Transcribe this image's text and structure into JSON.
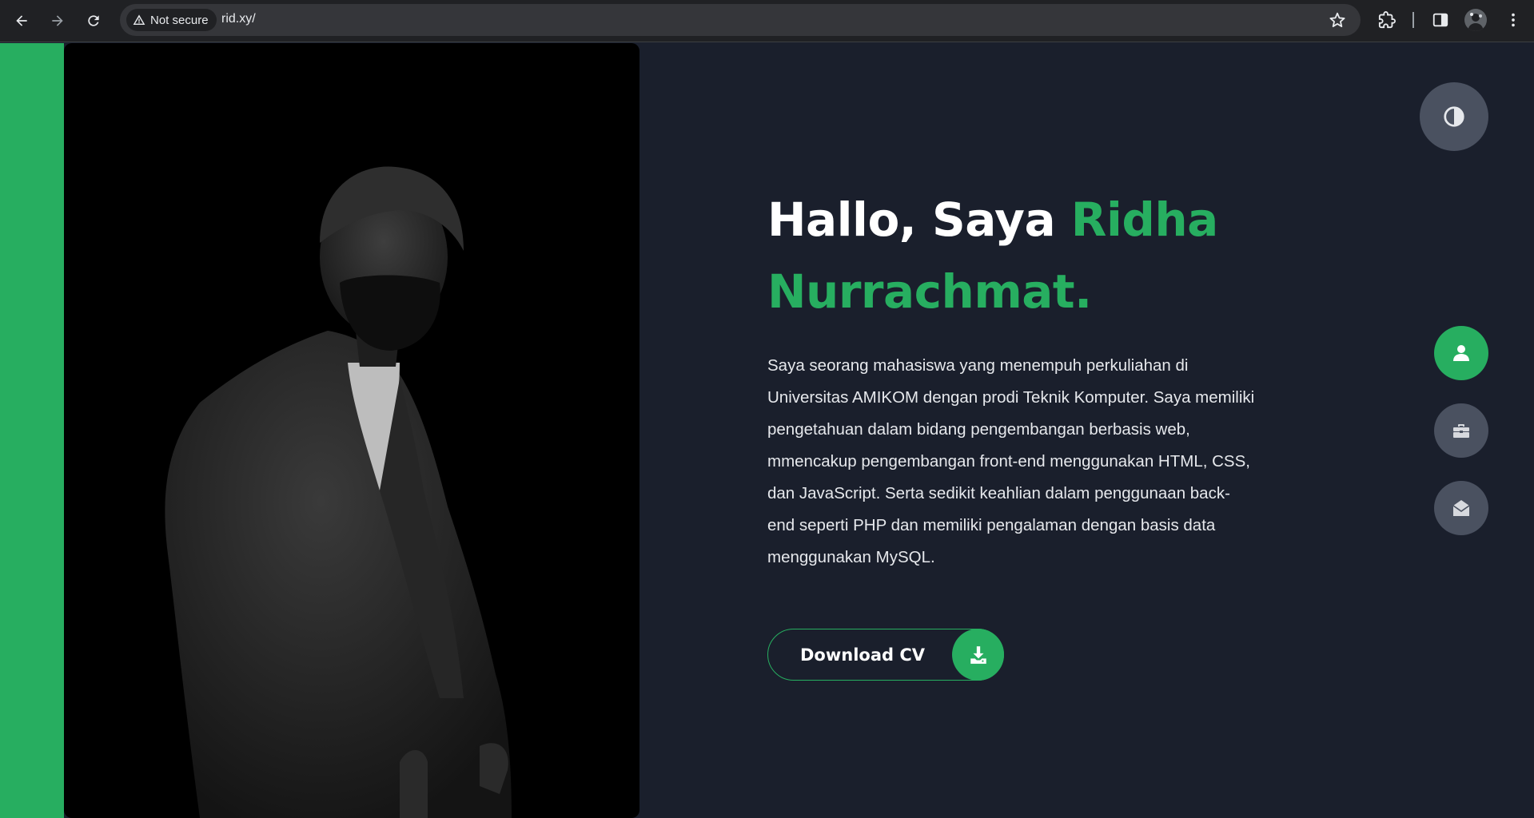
{
  "browser": {
    "security_label": "Not secure",
    "url": "rid.xy/"
  },
  "hero": {
    "greeting": "Hallo, Saya ",
    "name_first": "Ridha",
    "name_last": "Nurrachmat.",
    "bio": "Saya seorang mahasiswa yang menempuh perkuliahan di Universitas AMIKOM dengan prodi Teknik Komputer. Saya memiliki pengetahuan dalam bidang pengembangan berbasis web, mmencakup pengembangan front-end menggunakan HTML, CSS, dan JavaScript. Serta sedikit keahlian dalam penggunaan back-end seperti PHP dan memiliki pengalaman dengan basis data menggunakan MySQL.",
    "cv_button_label": "Download CV"
  },
  "colors": {
    "accent": "#27ae60",
    "background": "#1a1f2c",
    "button_gray": "#4a5160"
  },
  "side_nav": {
    "items": [
      {
        "icon": "user-icon",
        "active": true
      },
      {
        "icon": "briefcase-icon",
        "active": false
      },
      {
        "icon": "envelope-open-icon",
        "active": false
      }
    ]
  }
}
